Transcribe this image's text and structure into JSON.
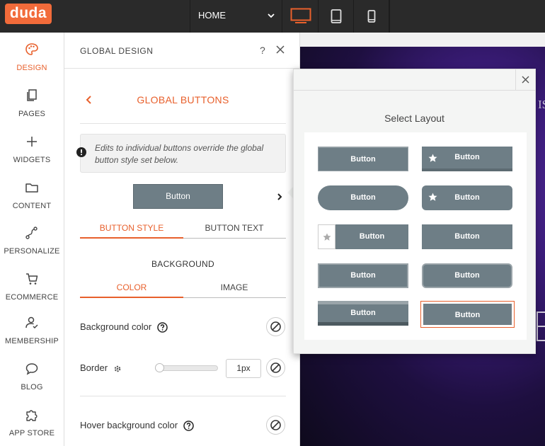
{
  "app": {
    "logo_text": "duda",
    "brand_color": "#f26b3a",
    "accent_color": "#e8602c"
  },
  "topbar": {
    "page_selector": "HOME",
    "devices": [
      {
        "name": "desktop",
        "icon": "desktop-icon",
        "active": true
      },
      {
        "name": "tablet",
        "icon": "tablet-icon",
        "active": false
      },
      {
        "name": "mobile",
        "icon": "mobile-icon",
        "active": false
      }
    ]
  },
  "leftnav": {
    "items": [
      {
        "label": "DESIGN",
        "icon": "palette-icon",
        "active": true
      },
      {
        "label": "PAGES",
        "icon": "pages-icon"
      },
      {
        "label": "WIDGETS",
        "icon": "plus-icon"
      },
      {
        "label": "CONTENT",
        "icon": "folder-icon"
      },
      {
        "label": "PERSONALIZE",
        "icon": "personalize-icon"
      },
      {
        "label": "ECOMMERCE",
        "icon": "cart-icon"
      },
      {
        "label": "MEMBERSHIP",
        "icon": "membership-icon"
      },
      {
        "label": "BLOG",
        "icon": "chat-bubble-icon"
      },
      {
        "label": "APP STORE",
        "icon": "puzzle-icon"
      }
    ]
  },
  "panel": {
    "title": "GLOBAL DESIGN",
    "help": "?",
    "subtitle": "GLOBAL BUTTONS",
    "notice": "Edits to individual buttons override the global button style set below.",
    "preview_button": "Button",
    "tabs": [
      "BUTTON STYLE",
      "BUTTON TEXT"
    ],
    "section_label": "BACKGROUND",
    "bg_tabs": [
      "COLOR",
      "IMAGE"
    ],
    "background_color_label": "Background color",
    "border_label": "Border",
    "border_value": "1px",
    "border_slider_fraction": 0.02,
    "hover_background_label": "Hover background color"
  },
  "site": {
    "hero_partial_text": "IS"
  },
  "layout_popover": {
    "title": "Select Layout",
    "button_label": "Button",
    "layouts": [
      {
        "style": "flat-bevel",
        "selected": false
      },
      {
        "style": "star-bottom-border",
        "selected": false
      },
      {
        "style": "pill",
        "selected": false
      },
      {
        "style": "star-rounded",
        "selected": false
      },
      {
        "style": "star-box",
        "selected": false
      },
      {
        "style": "flat",
        "selected": false
      },
      {
        "style": "outlined",
        "selected": false
      },
      {
        "style": "outlined-rounded",
        "selected": false
      },
      {
        "style": "top-bottom-border",
        "selected": false
      },
      {
        "style": "framed",
        "selected": true
      }
    ]
  }
}
